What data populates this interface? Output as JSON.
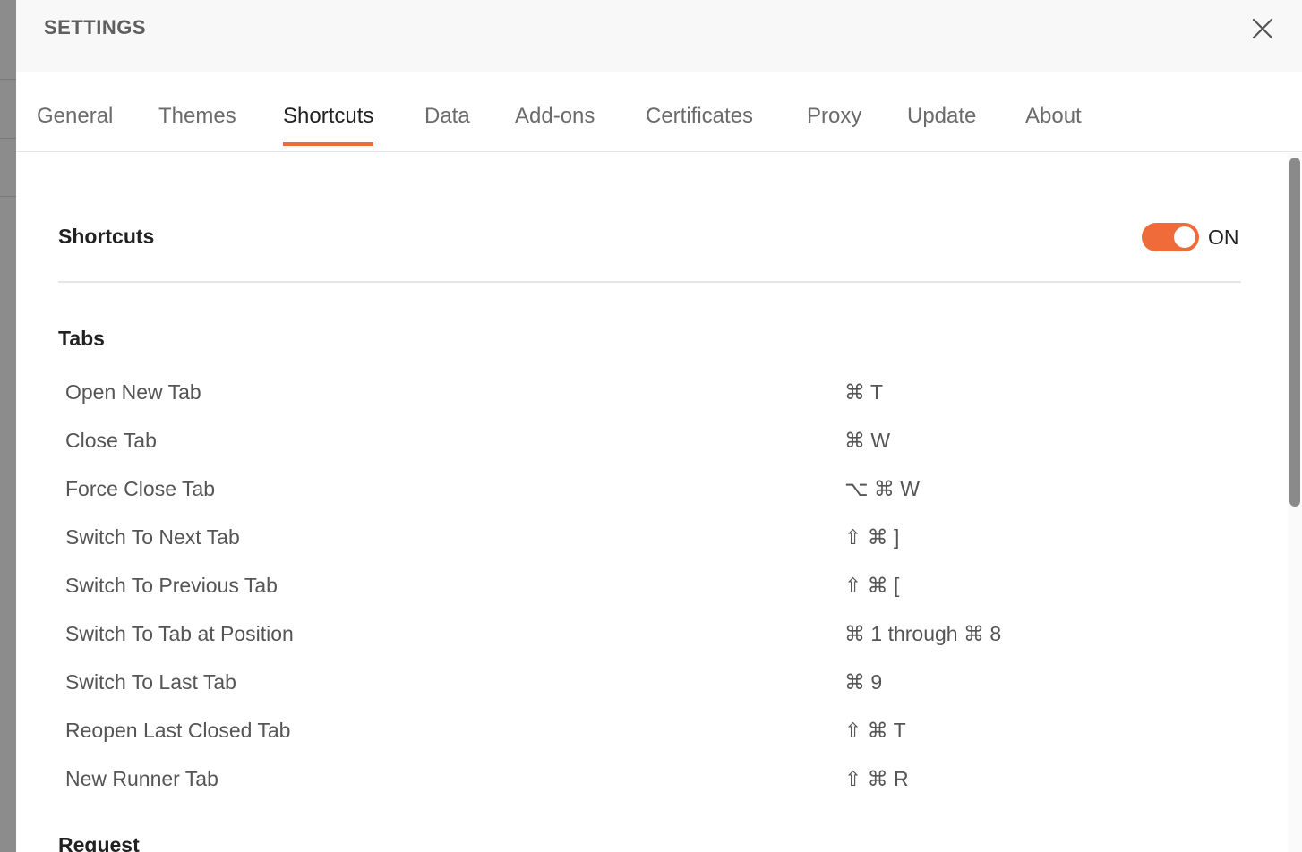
{
  "header": {
    "title": "SETTINGS"
  },
  "tabs": [
    {
      "label": "General"
    },
    {
      "label": "Themes"
    },
    {
      "label": "Shortcuts"
    },
    {
      "label": "Data"
    },
    {
      "label": "Add-ons"
    },
    {
      "label": "Certificates"
    },
    {
      "label": "Proxy"
    },
    {
      "label": "Update"
    },
    {
      "label": "About"
    }
  ],
  "active_tab": "Shortcuts",
  "shortcuts": {
    "heading": "Shortcuts",
    "toggle_state": "ON",
    "accent_color": "#ef6c3a"
  },
  "groups": [
    {
      "title": "Tabs",
      "items": [
        {
          "name": "Open New Tab",
          "keys": "⌘ T"
        },
        {
          "name": "Close Tab",
          "keys": "⌘ W"
        },
        {
          "name": "Force Close Tab",
          "keys": "⌥ ⌘ W"
        },
        {
          "name": "Switch To Next Tab",
          "keys": "⇧ ⌘ ]"
        },
        {
          "name": "Switch To Previous Tab",
          "keys": "⇧ ⌘ ["
        },
        {
          "name": "Switch To Tab at Position",
          "keys": "⌘ 1 through ⌘ 8"
        },
        {
          "name": "Switch To Last Tab",
          "keys": "⌘ 9"
        },
        {
          "name": "Reopen Last Closed Tab",
          "keys": "⇧ ⌘ T"
        },
        {
          "name": "New Runner Tab",
          "keys": "⇧ ⌘ R"
        }
      ]
    },
    {
      "title": "Request",
      "items": []
    }
  ]
}
